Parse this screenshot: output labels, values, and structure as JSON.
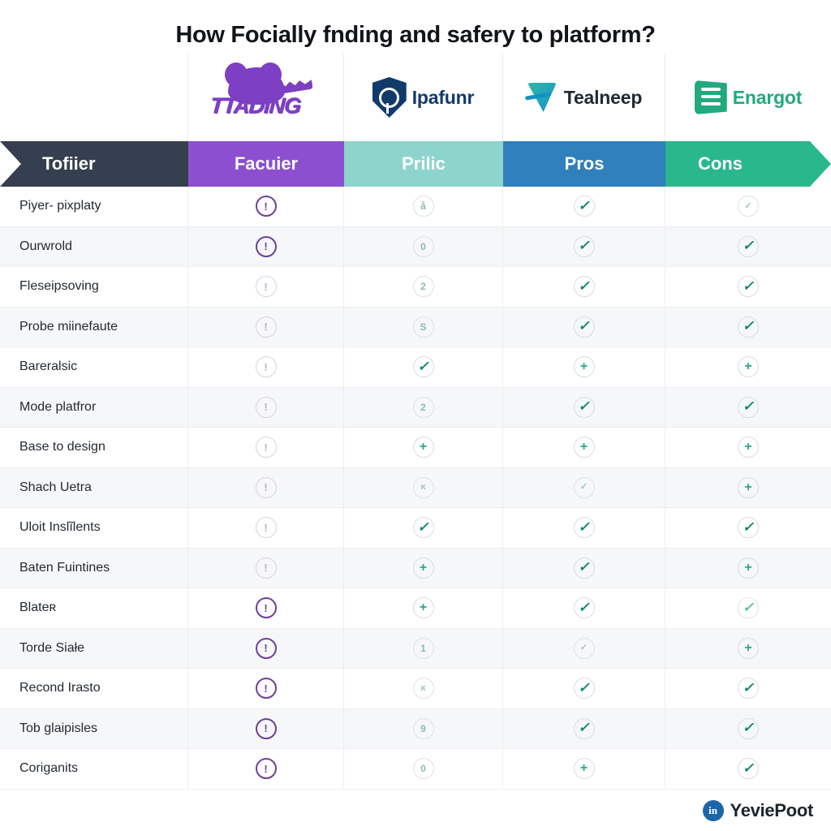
{
  "title": "How Focially fnding and safery to platform?",
  "brands": [
    {
      "name": "TTADING",
      "mark": "purple-blob-icon",
      "color": "#7d3fc4"
    },
    {
      "name": "Ipafunr",
      "mark": "navy-shield-icon",
      "color": "#123a6b"
    },
    {
      "name": "Tealneep",
      "mark": "teal-arrow-icon",
      "color": "#1f2a33"
    },
    {
      "name": "Enargot",
      "mark": "green-waves-icon",
      "color": "#22a97e"
    }
  ],
  "header": {
    "columns": [
      {
        "label": "Tofiier",
        "color": "#353f4f"
      },
      {
        "label": "Facuier",
        "color": "#8b4fd0"
      },
      {
        "label": "Prilic",
        "color": "#8dd5cc"
      },
      {
        "label": "Pros",
        "color": "#2f80bd"
      },
      {
        "label": "Cons",
        "color": "#29b88c"
      }
    ]
  },
  "rows": [
    {
      "label": "Piyer- pixplaty",
      "cells": [
        "warn-strong",
        "info-a",
        "check-strong",
        "mini-check"
      ]
    },
    {
      "label": "Ourwrold",
      "cells": [
        "warn-strong",
        "info-0",
        "check-strong",
        "check-strong"
      ]
    },
    {
      "label": "Fleseipsoving",
      "cells": [
        "warn-soft",
        "info-2",
        "check-strong",
        "check-strong"
      ]
    },
    {
      "label": "Probe miinefaute",
      "cells": [
        "warn-soft",
        "info-s",
        "check-strong",
        "check-strong"
      ]
    },
    {
      "label": "Bareralsic",
      "cells": [
        "warn-soft",
        "check-strong",
        "plus",
        "plus"
      ]
    },
    {
      "label": "Mode platfror",
      "cells": [
        "warn-soft",
        "info-2",
        "check-strong",
        "check-strong"
      ]
    },
    {
      "label": "Base to design",
      "cells": [
        "warn-soft",
        "plus",
        "plus",
        "plus"
      ]
    },
    {
      "label": "Shach Uetra",
      "cells": [
        "warn-soft",
        "mini-x",
        "mini-check",
        "plus"
      ]
    },
    {
      "label": "Uloit Inslĩlents",
      "cells": [
        "warn-soft",
        "check-strong",
        "check-strong",
        "check-strong"
      ]
    },
    {
      "label": "Baten Fuintines",
      "cells": [
        "warn-soft",
        "plus",
        "check-strong",
        "plus"
      ]
    },
    {
      "label": "Blateʀ",
      "cells": [
        "warn-strong",
        "plus",
        "check-strong",
        "check-soft"
      ]
    },
    {
      "label": "Torde Siałe",
      "cells": [
        "warn-strong",
        "info-1",
        "mini-check",
        "plus"
      ]
    },
    {
      "label": "Recond Irasto",
      "cells": [
        "warn-strong",
        "mini-x",
        "check-strong",
        "check-strong"
      ]
    },
    {
      "label": "Tob ɡlaipisles",
      "cells": [
        "warn-strong",
        "info-9",
        "check-strong",
        "check-strong"
      ]
    },
    {
      "label": "Coriganits",
      "cells": [
        "warn-strong",
        "info-0",
        "plus",
        "check-strong"
      ]
    }
  ],
  "watermark": {
    "icon": "linkedin-icon",
    "icon_glyph": "in",
    "text": "YeviePoot"
  },
  "glyphs": {
    "warn": "!",
    "plus": "+",
    "check": "✓",
    "info-a": "å",
    "info-0": "0",
    "info-1": "1",
    "info-2": "2",
    "info-9": "9",
    "info-s": "S",
    "mini-x": "ĸ"
  }
}
